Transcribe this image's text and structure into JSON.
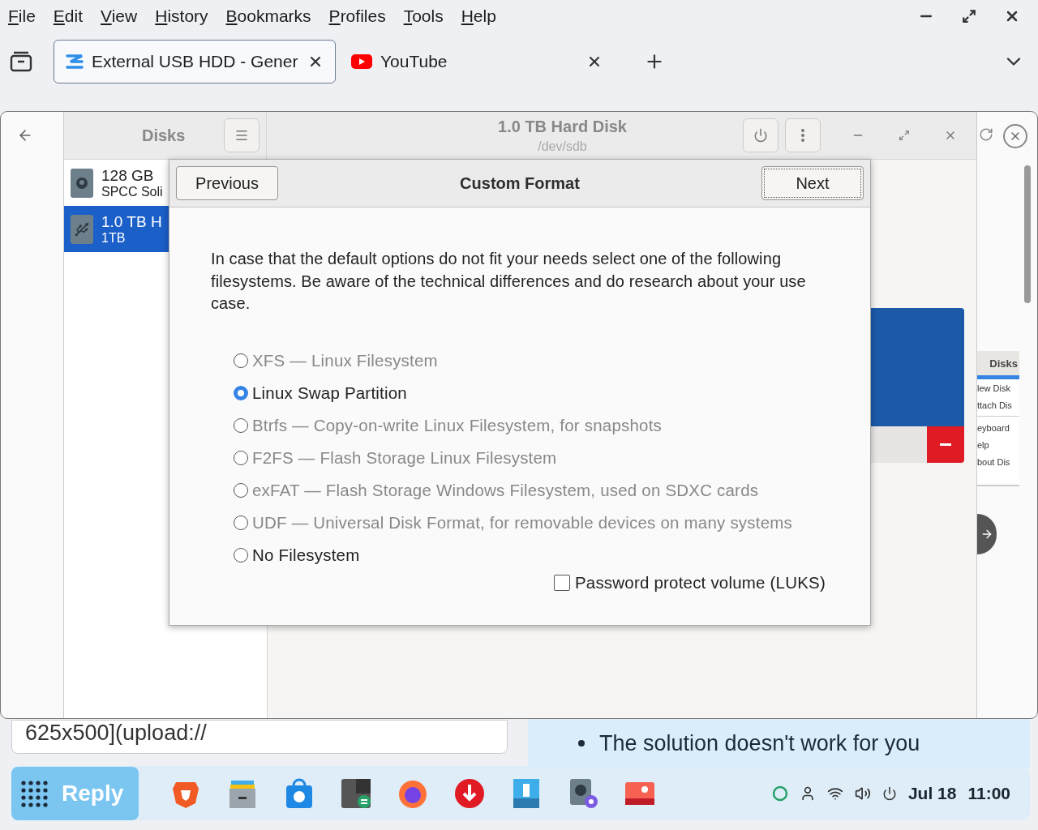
{
  "browser": {
    "menu": [
      "File",
      "Edit",
      "View",
      "History",
      "Bookmarks",
      "Profiles",
      "Tools",
      "Help"
    ],
    "tabs": [
      {
        "label": "External USB HDD - Gener",
        "selected": true,
        "kind": "disks"
      },
      {
        "label": "YouTube",
        "selected": false,
        "kind": "video"
      }
    ]
  },
  "page": {
    "upload_text": "625x500](upload://",
    "bullet": "The solution doesn't work for you",
    "reply": "Reply"
  },
  "disks": {
    "app_title": "Disks",
    "drive_title": "1.0 TB Hard Disk",
    "drive_path": "/dev/sdb",
    "drives": [
      {
        "name": "128 GB",
        "detail": "SPCC Soli",
        "selected": false,
        "kind": "ssd"
      },
      {
        "name": "1.0 TB H",
        "detail": "1TB",
        "selected": true,
        "kind": "usb"
      }
    ],
    "thumbnail": {
      "title": "Disks",
      "items": [
        "lew Disk",
        "ttach Dis",
        "eyboard",
        "elp",
        "bout Dis"
      ]
    }
  },
  "dialog": {
    "previous": "Previous",
    "title": "Custom Format",
    "next": "Next",
    "intro": "In case that the default options do not fit your needs select one of the following filesystems. Be aware of the technical differences and do research about your use case.",
    "options": [
      {
        "label": "XFS — Linux Filesystem",
        "selected": false,
        "disabled": true
      },
      {
        "label": "Linux Swap Partition",
        "selected": true,
        "disabled": false
      },
      {
        "label": "Btrfs — Copy-on-write Linux Filesystem, for snapshots",
        "selected": false,
        "disabled": true
      },
      {
        "label": "F2FS — Flash Storage Linux Filesystem",
        "selected": false,
        "disabled": true
      },
      {
        "label": "exFAT — Flash Storage Windows Filesystem, used on SDXC cards",
        "selected": false,
        "disabled": true
      },
      {
        "label": "UDF — Universal Disk Format, for removable devices on many systems",
        "selected": false,
        "disabled": true
      },
      {
        "label": "No Filesystem",
        "selected": false,
        "disabled": false
      }
    ],
    "luks": {
      "label": "Password protect volume (LUKS)",
      "checked": false
    }
  },
  "taskbar": {
    "date": "Jul 18",
    "time": "11:00"
  }
}
